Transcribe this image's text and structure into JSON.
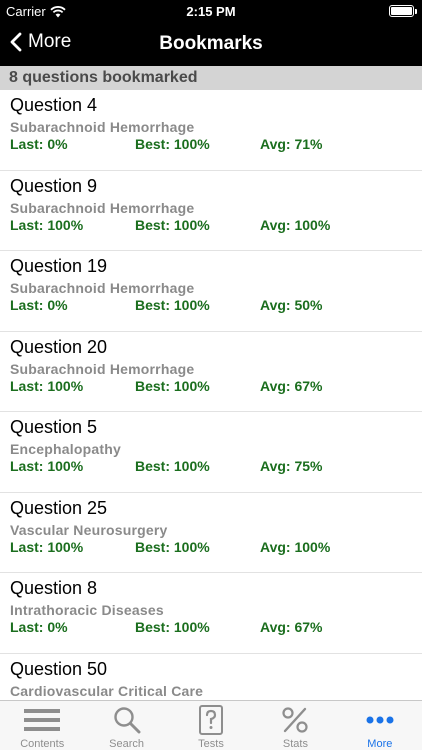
{
  "status_bar": {
    "carrier": "Carrier",
    "time": "2:15 PM"
  },
  "nav": {
    "back_label": "More",
    "title": "Bookmarks"
  },
  "section": {
    "header": "8 questions bookmarked"
  },
  "questions": [
    {
      "title": "Question 4",
      "topic": "Subarachnoid Hemorrhage",
      "last": "Last: 0%",
      "best": "Best: 100%",
      "avg": "Avg: 71%"
    },
    {
      "title": "Question 9",
      "topic": "Subarachnoid Hemorrhage",
      "last": "Last: 100%",
      "best": "Best: 100%",
      "avg": "Avg: 100%"
    },
    {
      "title": "Question 19",
      "topic": "Subarachnoid Hemorrhage",
      "last": "Last: 0%",
      "best": "Best: 100%",
      "avg": "Avg: 50%"
    },
    {
      "title": "Question 20",
      "topic": "Subarachnoid Hemorrhage",
      "last": "Last: 100%",
      "best": "Best: 100%",
      "avg": "Avg: 67%"
    },
    {
      "title": "Question 5",
      "topic": "Encephalopathy",
      "last": "Last: 100%",
      "best": "Best: 100%",
      "avg": "Avg: 75%"
    },
    {
      "title": "Question 25",
      "topic": "Vascular Neurosurgery",
      "last": "Last: 100%",
      "best": "Best: 100%",
      "avg": "Avg: 100%"
    },
    {
      "title": "Question 8",
      "topic": "Intrathoracic Diseases",
      "last": "Last: 0%",
      "best": "Best: 100%",
      "avg": "Avg: 67%"
    },
    {
      "title": "Question 50",
      "topic": "Cardiovascular Critical Care",
      "last": "",
      "best": "",
      "avg": ""
    }
  ],
  "tabs": [
    {
      "label": "Contents",
      "icon": "list-icon"
    },
    {
      "label": "Search",
      "icon": "search-icon"
    },
    {
      "label": "Tests",
      "icon": "question-card-icon"
    },
    {
      "label": "Stats",
      "icon": "percent-icon"
    },
    {
      "label": "More",
      "icon": "more-dots-icon",
      "active": true
    }
  ],
  "colors": {
    "stat_green": "#1b6e1e",
    "active_tab": "#1a73e8",
    "header_bg": "#d4d4d4"
  }
}
